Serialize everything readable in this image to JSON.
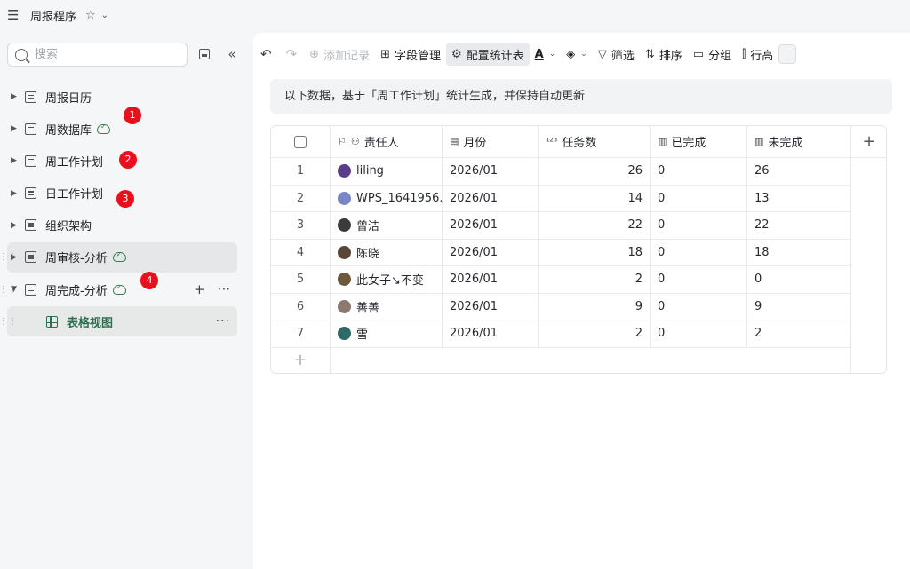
{
  "app": {
    "title": "周报程序"
  },
  "sidebar": {
    "search_placeholder": "搜索",
    "items": [
      {
        "label": "周报日历",
        "synced": false
      },
      {
        "label": "周数据库",
        "synced": true
      },
      {
        "label": "周工作计划",
        "synced": false
      },
      {
        "label": "日工作计划",
        "synced": false
      },
      {
        "label": "组织架构",
        "synced": false
      },
      {
        "label": "周审核-分析",
        "synced": true
      },
      {
        "label": "周完成-分析",
        "synced": true,
        "expanded": true
      }
    ],
    "view": {
      "label": "表格视图"
    },
    "badges": [
      "1",
      "2",
      "3",
      "4"
    ]
  },
  "toolbar": {
    "add_record": "添加记录",
    "fields": "字段管理",
    "stats_config": "配置统计表",
    "filter": "筛选",
    "sort": "排序",
    "group": "分组",
    "row_height": "行高"
  },
  "notice": "以下数据，基于「周工作计划」统计生成，并保持自动更新",
  "table": {
    "columns": [
      "责任人",
      "月份",
      "任务数",
      "已完成",
      "未完成"
    ],
    "rows": [
      {
        "index": "1",
        "owner": "liling",
        "month": "2026/01",
        "tasks": "26",
        "done": "0",
        "undone": "26",
        "avatar_color": "#5a3e8c"
      },
      {
        "index": "2",
        "owner": "WPS_1641956...",
        "month": "2026/01",
        "tasks": "14",
        "done": "0",
        "undone": "13",
        "avatar_color": "#7b86c9"
      },
      {
        "index": "3",
        "owner": "曾洁",
        "month": "2026/01",
        "tasks": "22",
        "done": "0",
        "undone": "22",
        "avatar_color": "#3b3b3b"
      },
      {
        "index": "4",
        "owner": "陈晓",
        "month": "2026/01",
        "tasks": "18",
        "done": "0",
        "undone": "18",
        "avatar_color": "#5a4636"
      },
      {
        "index": "5",
        "owner": "此女子↘不变",
        "month": "2026/01",
        "tasks": "2",
        "done": "0",
        "undone": "0",
        "avatar_color": "#6d5a3c"
      },
      {
        "index": "6",
        "owner": "善善",
        "month": "2026/01",
        "tasks": "9",
        "done": "0",
        "undone": "9",
        "avatar_color": "#8c7a70"
      },
      {
        "index": "7",
        "owner": "雪",
        "month": "2026/01",
        "tasks": "2",
        "done": "0",
        "undone": "2",
        "avatar_color": "#2e6a6a"
      }
    ]
  }
}
